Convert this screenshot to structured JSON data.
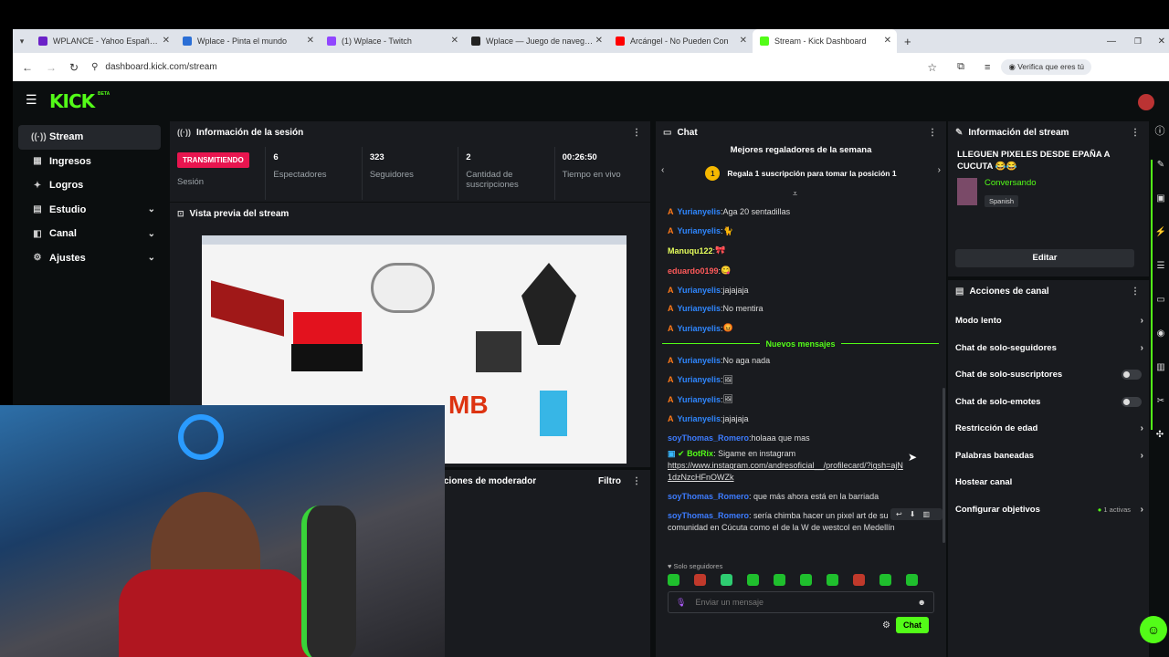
{
  "browser": {
    "tabs": [
      {
        "title": "WPLANCE - Yahoo España Res",
        "color": "#6b21c8"
      },
      {
        "title": "Wplace - Pinta el mundo",
        "color": "#2b6fd6"
      },
      {
        "title": "(1) Wplace - Twitch",
        "color": "#9146ff"
      },
      {
        "title": "Wplace — Juego de navegado",
        "color": "#222222"
      },
      {
        "title": "Arcángel - No Pueden Con",
        "color": "#ff0000"
      },
      {
        "title": "Stream - Kick Dashboard",
        "color": "#53fc18"
      }
    ],
    "new_tab": "+",
    "url": "dashboard.kick.com/stream",
    "profile_label": "Verifica que eres tú"
  },
  "brand": {
    "logo": "KICK",
    "beta": "BETA",
    "accent": "#53fc18"
  },
  "sidebar": {
    "items": [
      {
        "label": "Stream",
        "icon": "broadcast-icon",
        "glyph": "((·))"
      },
      {
        "label": "Ingresos",
        "icon": "money-icon",
        "glyph": "▦"
      },
      {
        "label": "Logros",
        "icon": "trophy-icon",
        "glyph": "✦"
      },
      {
        "label": "Estudio",
        "icon": "studio-icon",
        "glyph": "▤"
      },
      {
        "label": "Canal",
        "icon": "channel-icon",
        "glyph": "◧"
      },
      {
        "label": "Ajustes",
        "icon": "gear-icon",
        "glyph": "⚙"
      }
    ]
  },
  "session": {
    "title": "Información de la sesión",
    "live_badge": "TRANSMITIENDO",
    "live_label": "Sesión",
    "stats": [
      {
        "value": "6",
        "label": "Espectadores"
      },
      {
        "value": "323",
        "label": "Seguidores"
      },
      {
        "value": "2",
        "label": "Cantidad de suscripciones"
      },
      {
        "value": "00:26:50",
        "label": "Tiempo en vivo"
      }
    ]
  },
  "preview": {
    "title": "Vista previa del stream"
  },
  "moderator": {
    "title": "ciones de moderador",
    "filter": "Filtro"
  },
  "chat": {
    "title": "Chat",
    "top_gifters_title": "Mejores regaladores de la semana",
    "top_gifters_rank": "1",
    "top_gifters_text": "Regala 1 suscripción para tomar la posición 1",
    "new_messages_label": "Nuevos mensajes",
    "messages_before": [
      {
        "user": "Yurianyelis",
        "sep": ": ",
        "text": "Aga 20 sentadillas",
        "color": "#2f87ff",
        "badge": "A"
      },
      {
        "user": "Yurianyelis",
        "sep": ": ",
        "text": "🐈",
        "color": "#2f87ff",
        "badge": "A"
      },
      {
        "user": "Manuqu122",
        "sep": ": ",
        "text": "🎀",
        "color": "#e7ff5c",
        "badge": ""
      },
      {
        "user": "eduardo0199",
        "sep": ": ",
        "text": "😋",
        "color": "#ff5a5a",
        "badge": ""
      },
      {
        "user": "Yurianyelis",
        "sep": ": ",
        "text": "jajajaja",
        "color": "#2f87ff",
        "badge": "A"
      },
      {
        "user": "Yurianyelis",
        "sep": ": ",
        "text": "No mentira",
        "color": "#2f87ff",
        "badge": "A"
      },
      {
        "user": "Yurianyelis",
        "sep": ": ",
        "text": "😡",
        "color": "#2f87ff",
        "badge": "A"
      }
    ],
    "messages_after": [
      {
        "user": "Yurianyelis",
        "sep": ": ",
        "text": "No aga nada",
        "color": "#2f87ff",
        "badge": "A"
      },
      {
        "user": "Yurianyelis",
        "sep": ": ",
        "text": "🖼",
        "color": "#2f87ff",
        "badge": "A"
      },
      {
        "user": "Yurianyelis",
        "sep": ": ",
        "text": "🖼",
        "color": "#2f87ff",
        "badge": "A"
      },
      {
        "user": "Yurianyelis",
        "sep": ": ",
        "text": "jajajaja",
        "color": "#2f87ff",
        "badge": "A"
      },
      {
        "user": "soyThomas_Romero",
        "sep": ": ",
        "text": "holaaa que mas",
        "color": "#3d7cff",
        "badge": ""
      }
    ],
    "bot": {
      "user": "BotRix",
      "text": "Sigame en instagram",
      "link": "https://www.instagram.com/andresoficial__/profilecard/?igsh=ajN1dzNzcHFnOWZk",
      "color": "#53fc18"
    },
    "messages_final": [
      {
        "user": "soyThomas_Romero",
        "text": "que más ahora está en la barriada",
        "color": "#3d7cff"
      },
      {
        "user": "soyThomas_Romero",
        "text": "sería chimba hacer un pixel art de su comunidad en Cúcuta como el de la W de westcol en Medellín",
        "color": "#3d7cff"
      }
    ],
    "followers_only_label": "Solo seguidores",
    "input_placeholder": "Enviar un mensaje",
    "send_label": "Chat"
  },
  "stream_info": {
    "title_label": "Información del stream",
    "stream_title": "LLEGUEN PIXELES DESDE EPAÑA A CUCUTA 😂😂",
    "category": "Conversando",
    "language": "Spanish",
    "edit_label": "Editar"
  },
  "channel_actions": {
    "title": "Acciones de canal",
    "items": [
      {
        "label": "Modo lento",
        "control": "arrow"
      },
      {
        "label": "Chat de solo-seguidores",
        "control": "arrow"
      },
      {
        "label": "Chat de solo-suscriptores",
        "control": "toggle"
      },
      {
        "label": "Chat de solo-emotes",
        "control": "toggle"
      },
      {
        "label": "Restricción de edad",
        "control": "arrow"
      },
      {
        "label": "Palabras baneadas",
        "control": "arrow"
      },
      {
        "label": "Hostear canal",
        "control": "none"
      },
      {
        "label": "Configurar objetivos",
        "control": "arrow"
      }
    ],
    "goals_active": "1 activas"
  }
}
